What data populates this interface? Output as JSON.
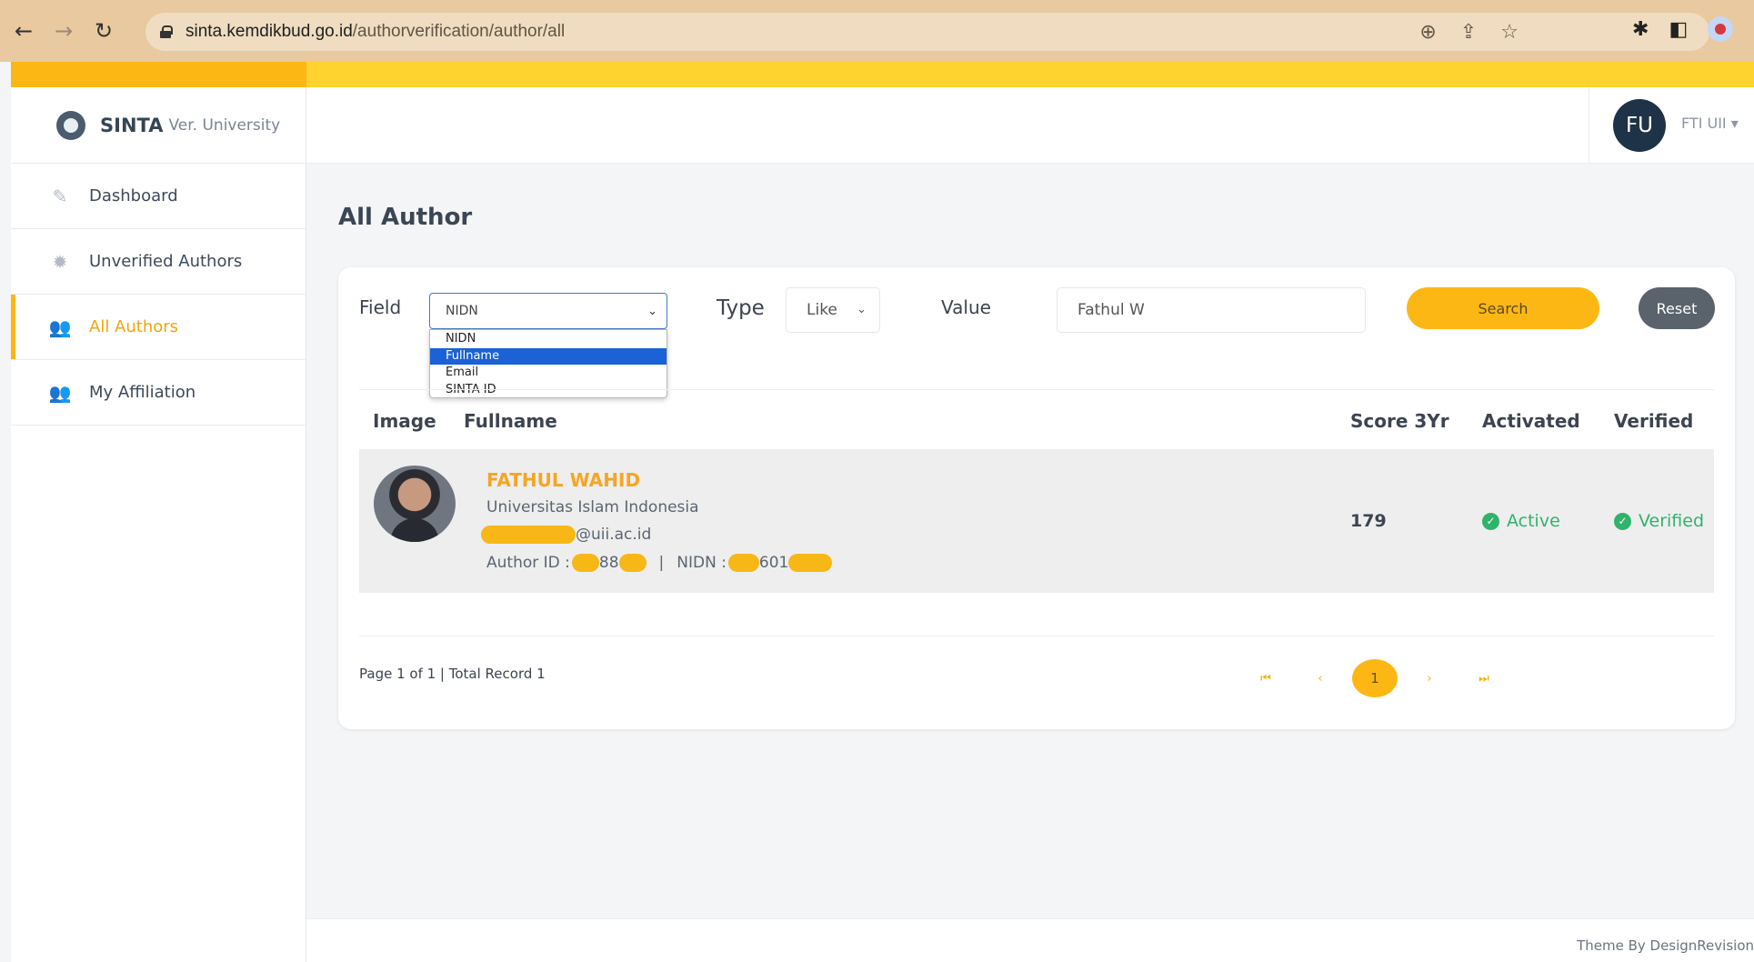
{
  "browser": {
    "url_host": "sinta.kemdikbud.go.id",
    "url_path": "/authorverification/author/all"
  },
  "sidebar": {
    "brand": "SINTA",
    "brand_sub": "Ver. University",
    "items": [
      {
        "label": "Dashboard",
        "icon": "pencil-icon"
      },
      {
        "label": "Unverified Authors",
        "icon": "badge-icon"
      },
      {
        "label": "All Authors",
        "icon": "users-icon",
        "active": true
      },
      {
        "label": "My Affiliation",
        "icon": "users-icon"
      }
    ]
  },
  "header": {
    "avatar_initials": "FU",
    "user_name": "FTI UII"
  },
  "main": {
    "title": "All Author",
    "filter": {
      "field_label": "Field",
      "field_selected": "NIDN",
      "field_options": [
        "NIDN",
        "Fullname",
        "Email",
        "SINTA ID"
      ],
      "field_highlighted": "Fullname",
      "type_label": "Type",
      "type_selected": "Like",
      "value_label": "Value",
      "value_input": "Fathul W",
      "search_button": "Search",
      "reset_button": "Reset"
    },
    "table": {
      "columns": [
        "Image",
        "Fullname",
        "Score 3Yr",
        "Activated",
        "Verified"
      ],
      "rows": [
        {
          "name": "FATHUL WAHID",
          "affiliation": "Universitas Islam Indonesia",
          "email_suffix": "@uii.ac.id",
          "author_id_label": "Author ID :",
          "author_id_visible": "88",
          "nidn_label": "NIDN :",
          "nidn_visible": "601",
          "separator": "|",
          "score": "179",
          "activated": "Active",
          "verified": "Verified"
        }
      ]
    },
    "pagination": {
      "info": "Page 1 of 1 | Total Record 1",
      "first": "⏮",
      "prev": "‹",
      "current": "1",
      "next": "›",
      "last": "⏭"
    }
  },
  "footer": {
    "theme_credit": "Theme By DesignRevision"
  },
  "colors": {
    "accent": "#fdb714",
    "success": "#2fb36b",
    "link": "#f5a623"
  }
}
